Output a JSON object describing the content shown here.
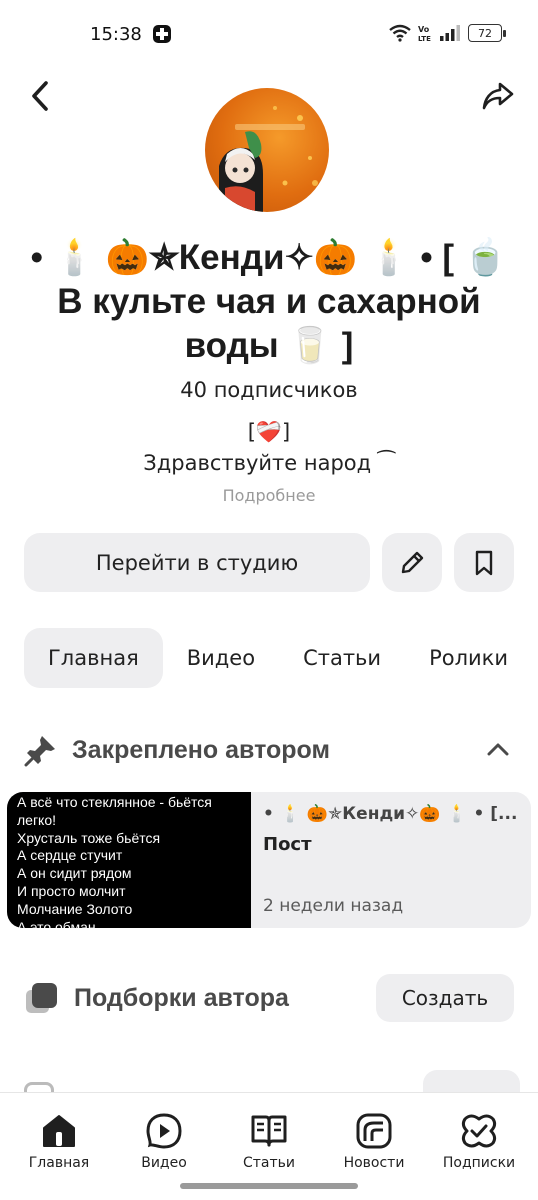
{
  "status_bar": {
    "time": "15:38",
    "battery": "72",
    "icons": [
      "app-notification-icon",
      "wifi-icon",
      "volte-icon",
      "signal-icon",
      "battery-icon"
    ]
  },
  "header": {
    "back_icon": "chevron-left-icon",
    "share_icon": "share-arrow-icon"
  },
  "channel": {
    "title": "• 🕯️ 🎃✯Кенди✧🎃 🕯️ • [ 🍵 В культе чая и сахарной воды 🥛 ]",
    "subscribers": "40 подписчиков",
    "description_heart": "[❤️‍🩹]",
    "description_text": "Здравствуйте народ ⁀",
    "more_label": "Подробнее"
  },
  "actions": {
    "studio_label": "Перейти в студию",
    "edit_icon": "pencil-icon",
    "bookmark_icon": "bookmark-icon"
  },
  "tabs": [
    {
      "label": "Главная",
      "active": true
    },
    {
      "label": "Видео",
      "active": false
    },
    {
      "label": "Статьи",
      "active": false
    },
    {
      "label": "Ролики",
      "active": false
    }
  ],
  "pinned": {
    "title": "Закреплено автором",
    "card": {
      "preview_lines": [
        "А всё что стеклянное - бьётся легко!",
        "Хрусталь тоже бьётся",
        "А сердце стучит",
        "А он сидит рядом",
        "И просто молчит",
        "Молчание Золото",
        "А это обман"
      ],
      "channel": "• 🕯️ 🎃✯Кенди✧🎃 🕯️ • [...",
      "kind": "Пост",
      "date": "2 недели назад"
    }
  },
  "collections": {
    "title": "Подборки автора",
    "create_label": "Создать"
  },
  "bottom_nav": [
    {
      "label": "Главная",
      "icon": "home-icon"
    },
    {
      "label": "Видео",
      "icon": "video-icon"
    },
    {
      "label": "Статьи",
      "icon": "articles-icon"
    },
    {
      "label": "Новости",
      "icon": "news-icon"
    },
    {
      "label": "Подписки",
      "icon": "subscriptions-icon"
    }
  ],
  "colors": {
    "button_bg": "#eeeef0",
    "text": "#1f1f1f",
    "muted": "#9a9a9a",
    "avatar_orange": "#e06d10"
  }
}
